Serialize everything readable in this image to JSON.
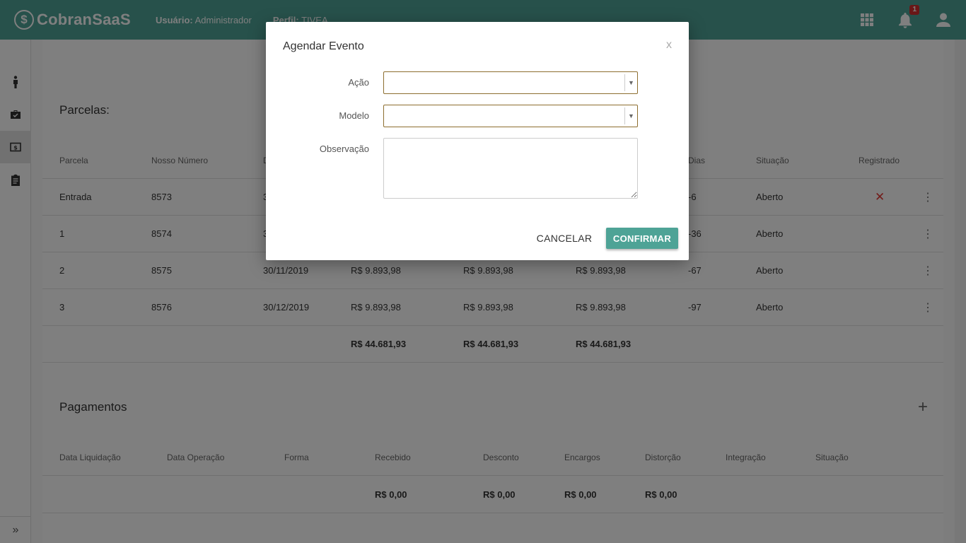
{
  "header": {
    "logo_text": "CobranSaaS",
    "user_label": "Usuário:",
    "user_value": "Administrador",
    "profile_label": "Perfil:",
    "profile_value": "TIVEA",
    "notification_count": "1"
  },
  "sidebar": {
    "items": [
      {
        "icon": "person-icon"
      },
      {
        "icon": "briefcase-check-icon"
      },
      {
        "icon": "money-icon",
        "active": true
      },
      {
        "icon": "clipboard-icon"
      }
    ],
    "expand_label": "»"
  },
  "parcelas": {
    "title": "Parcelas:",
    "columns": [
      "Parcela",
      "Nosso Número",
      "D",
      "Dias",
      "Situação",
      "Registrado"
    ],
    "rows": [
      {
        "parcela": "Entrada",
        "nosso_numero": "8573",
        "vencimento": "3",
        "valor": "",
        "corrigido": "",
        "saldo": "",
        "dias": "-6",
        "situacao": "Aberto",
        "registrado": "✕"
      },
      {
        "parcela": "1",
        "nosso_numero": "8574",
        "vencimento": "3",
        "valor": "",
        "corrigido": "",
        "saldo": "",
        "dias": "-36",
        "situacao": "Aberto",
        "registrado": ""
      },
      {
        "parcela": "2",
        "nosso_numero": "8575",
        "vencimento": "30/11/2019",
        "valor": "R$ 9.893,98",
        "corrigido": "R$ 9.893,98",
        "saldo": "R$ 9.893,98",
        "dias": "-67",
        "situacao": "Aberto",
        "registrado": ""
      },
      {
        "parcela": "3",
        "nosso_numero": "8576",
        "vencimento": "30/12/2019",
        "valor": "R$ 9.893,98",
        "corrigido": "R$ 9.893,98",
        "saldo": "R$ 9.893,98",
        "dias": "-97",
        "situacao": "Aberto",
        "registrado": ""
      }
    ],
    "totals": {
      "valor": "R$ 44.681,93",
      "corrigido": "R$ 44.681,93",
      "saldo": "R$ 44.681,93"
    }
  },
  "pagamentos": {
    "title": "Pagamentos",
    "add_label": "+",
    "columns": [
      "Data Liquidação",
      "Data Operação",
      "Forma",
      "Recebido",
      "Desconto",
      "Encargos",
      "Distorção",
      "Integração",
      "Situação"
    ],
    "totals": {
      "recebido": "R$ 0,00",
      "desconto": "R$ 0,00",
      "encargos": "R$ 0,00",
      "distorcao": "R$ 0,00"
    }
  },
  "modal": {
    "title": "Agendar Evento",
    "close_label": "x",
    "acao_label": "Ação",
    "acao_value": "",
    "modelo_label": "Modelo",
    "modelo_value": "",
    "observacao_label": "Observação",
    "observacao_value": "",
    "cancel_label": "CANCELAR",
    "confirm_label": "CONFIRMAR"
  },
  "colors": {
    "brand": "#4ea396",
    "select_border": "#8d6e2f",
    "danger": "#e53935"
  }
}
